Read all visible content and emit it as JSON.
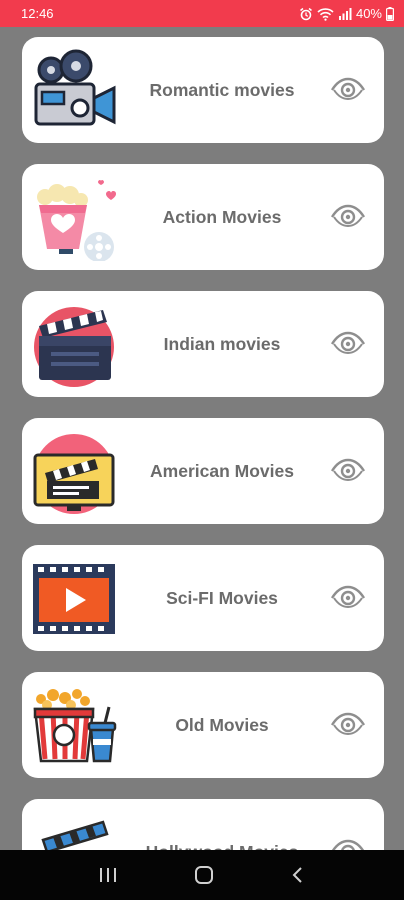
{
  "status_bar": {
    "time": "12:46",
    "battery": "40%",
    "icons": [
      "alarm-icon",
      "wifi-icon",
      "signal-icon",
      "battery-icon"
    ],
    "background": "#f23b4d"
  },
  "categories": [
    {
      "label": "Romantic movies",
      "icon": "film-camera-icon"
    },
    {
      "label": "Action Movies",
      "icon": "popcorn-hearts-icon"
    },
    {
      "label": "Indian movies",
      "icon": "clapperboard-icon"
    },
    {
      "label": "American Movies",
      "icon": "tv-clapperboard-icon"
    },
    {
      "label": "Sci-FI Movies",
      "icon": "film-play-icon"
    },
    {
      "label": "Old Movies",
      "icon": "popcorn-soda-icon"
    },
    {
      "label": "Hollywood Movies",
      "icon": "clapperboard-icon"
    }
  ],
  "nav_bar": {
    "icons": [
      "recent-apps-icon",
      "home-icon",
      "back-icon"
    ]
  },
  "colors": {
    "background": "#7d7d7d",
    "card": "#ffffff",
    "label": "#6b6b6b"
  }
}
